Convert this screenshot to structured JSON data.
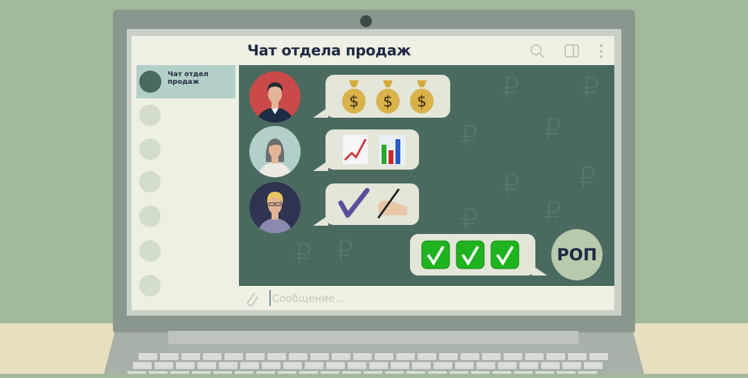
{
  "header": {
    "title": "Чат отдела продаж",
    "search_icon": "search-icon",
    "panel_icon": "sidebar-toggle-icon",
    "menu_icon": "more-vertical-icon"
  },
  "sidebar": {
    "selected_chat": "Чат отдел продаж"
  },
  "messages": [
    {
      "sender": "manager-male",
      "content": [
        "money-bag",
        "money-bag",
        "money-bag"
      ]
    },
    {
      "sender": "manager-female",
      "content": [
        "chart-increasing",
        "bar-chart"
      ]
    },
    {
      "sender": "manager-blonde",
      "content": [
        "check-mark",
        "writing-hand"
      ]
    },
    {
      "sender": "self",
      "content": [
        "check-box",
        "check-box",
        "check-box"
      ]
    }
  ],
  "self_avatar": "РОП",
  "input": {
    "placeholder": "Сообщение...",
    "attach_icon": "paperclip-icon"
  },
  "colors": {
    "chat_bg": "#4a6a60",
    "bubble": "#e3e6d8",
    "accent": "#b2d0c9"
  }
}
